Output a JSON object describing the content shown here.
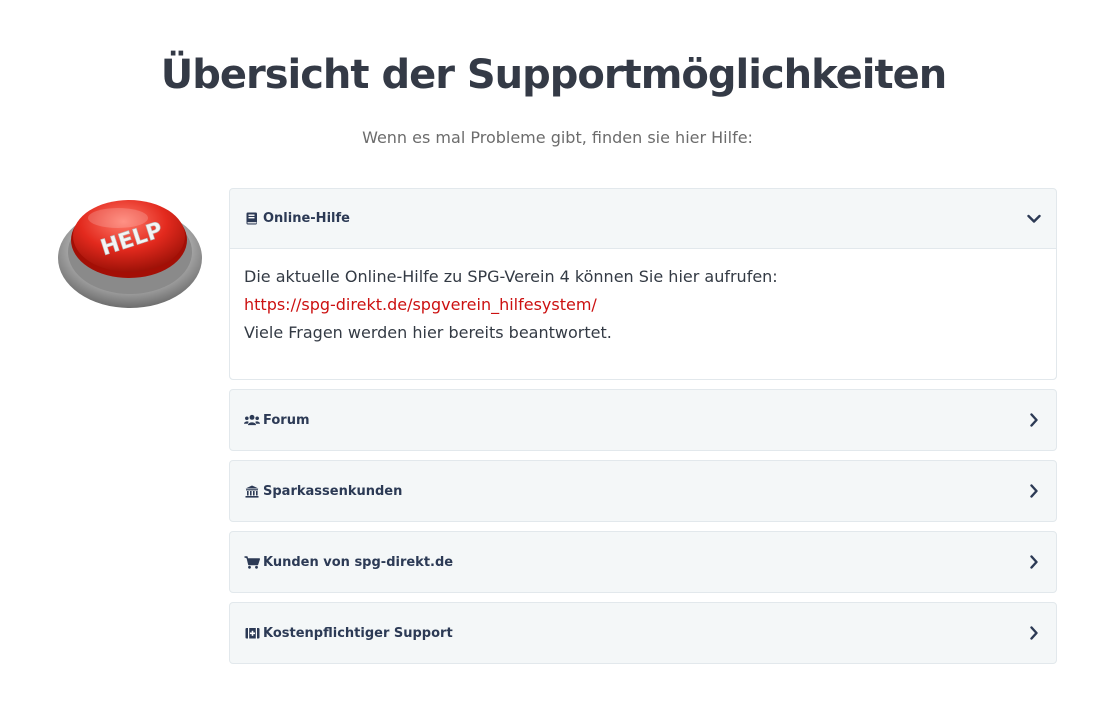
{
  "header": {
    "title": "Übersicht der Supportmöglichkeiten",
    "subtitle": "Wenn es mal Probleme gibt, finden sie hier Hilfe:"
  },
  "help_image": {
    "label": "HELP"
  },
  "accordion": {
    "items": [
      {
        "icon": "book-icon",
        "title": "Online-Hilfe",
        "expanded": true,
        "body": {
          "line1": "Die aktuelle Online-Hilfe zu SPG-Verein 4 können Sie hier aufrufen:",
          "link": "https://spg-direkt.de/spgverein_hilfesystem/",
          "line3": "Viele Fragen werden hier bereits beantwortet."
        }
      },
      {
        "icon": "users-icon",
        "title": "Forum",
        "expanded": false
      },
      {
        "icon": "bank-icon",
        "title": "Sparkassenkunden",
        "expanded": false
      },
      {
        "icon": "shopping-cart-icon",
        "title": "Kunden von spg-direkt.de",
        "expanded": false
      },
      {
        "icon": "medkit-icon",
        "title": "Kostenpflichtiger Support",
        "expanded": false
      }
    ]
  },
  "colors": {
    "link": "#cc1111",
    "title": "#343a46",
    "panel_bg": "#f4f7f8",
    "header_text": "#2c3a55"
  }
}
